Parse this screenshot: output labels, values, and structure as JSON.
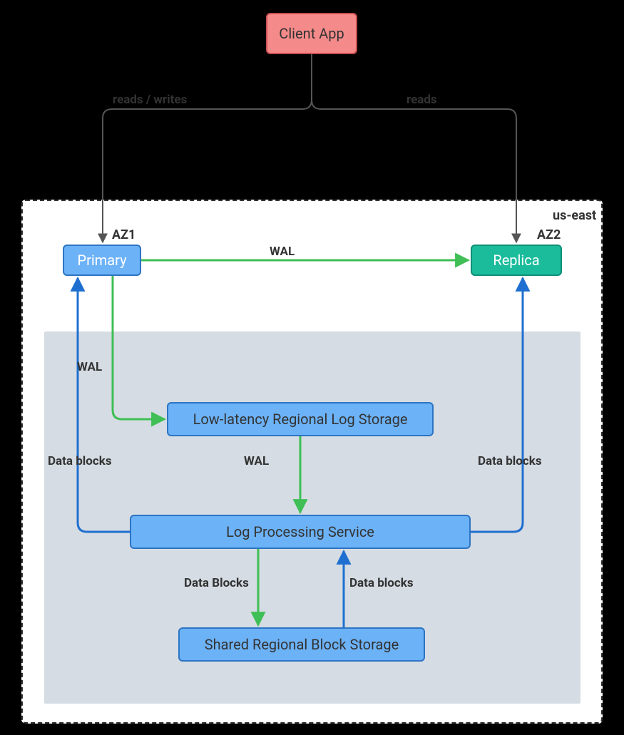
{
  "nodes": {
    "client": "Client App",
    "primary": "Primary",
    "replica": "Replica",
    "log_storage": "Low-latency Regional Log Storage",
    "log_service": "Log Processing Service",
    "block_storage": "Shared Regional Block Storage"
  },
  "labels": {
    "region": "us-east",
    "az1": "AZ1",
    "az2": "AZ2"
  },
  "edges": {
    "client_primary": "reads / writes",
    "client_replica": "reads",
    "primary_replica": "WAL",
    "primary_logstore": "WAL",
    "logstore_service": "WAL",
    "service_primary": "Data blocks",
    "service_replica": "Data blocks",
    "service_block": "Data Blocks",
    "block_service": "Data blocks"
  },
  "colors": {
    "green": "#3fbf55",
    "blue": "#1f6fd0",
    "gray": "#555555"
  }
}
